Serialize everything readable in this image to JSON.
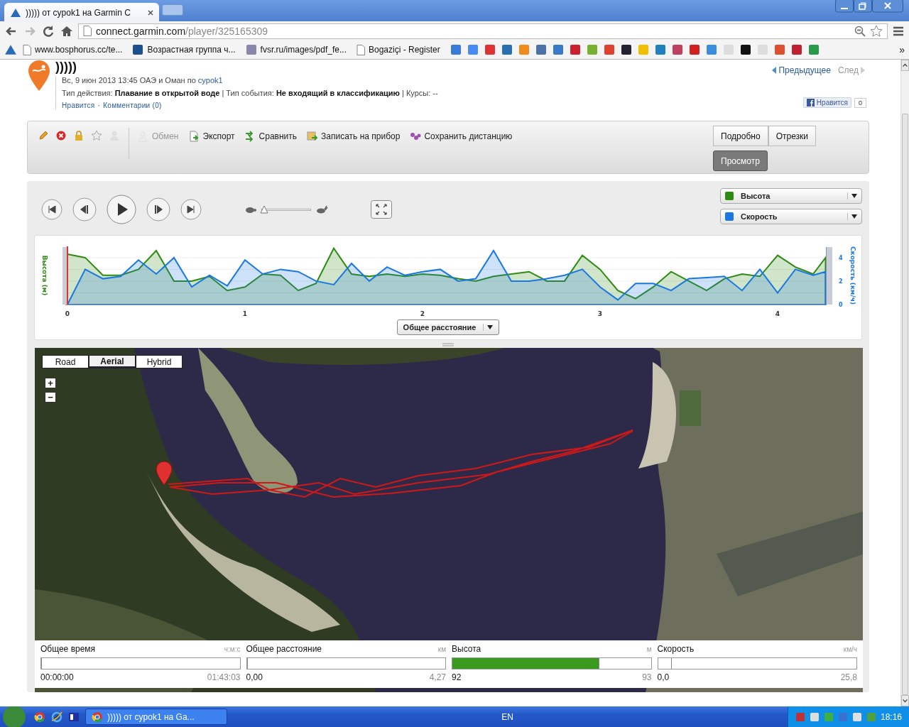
{
  "browser": {
    "tab_title": "))))) от cypok1 на Garmin C",
    "url_host": "connect.garmin.com",
    "url_path": "/player/325165309",
    "bookmarks": [
      "www.bosphorus.cc/te...",
      "Возрастная группа ч...",
      "fvsr.ru/images/pdf_fe...",
      "Bogaziçi - Register"
    ],
    "more": "»"
  },
  "activity": {
    "title": ")))))",
    "meta": "Вс, 9 июн 2013 13:45 ОАЭ и Оман по",
    "author": "cypok1",
    "details": "Тип действия: **Плавание в открытой воде** | Тип события: **Не входящий в классификацию** | Курсы: --",
    "like": "Нравится",
    "separator": "·",
    "comments": "Комментарии (0)",
    "prev": "Предыдущее",
    "next": "След",
    "next_disabled": true,
    "fb_like": "Нравится",
    "fb_count": "0"
  },
  "toolbar": {
    "icons": [
      {
        "kind": "edit",
        "disabled": false
      },
      {
        "kind": "delete",
        "disabled": false
      },
      {
        "kind": "lock",
        "disabled": false
      },
      {
        "kind": "star",
        "disabled": false
      },
      {
        "kind": "user",
        "disabled": true
      }
    ],
    "actions": [
      {
        "kind": "share",
        "label": "Обмен",
        "disabled": true
      },
      {
        "kind": "export",
        "label": "Экспорт",
        "disabled": false
      },
      {
        "kind": "compare",
        "label": "Сравнить",
        "disabled": false
      },
      {
        "kind": "device",
        "label": "Записать на прибор",
        "disabled": false
      },
      {
        "kind": "course",
        "label": "Сохранить дистанцию",
        "disabled": false
      }
    ],
    "views": [
      {
        "label": "Подробно",
        "selected": false
      },
      {
        "label": "Отрезки",
        "selected": false
      },
      {
        "label": "Просмотр",
        "selected": true
      }
    ]
  },
  "player": {
    "speed_slider": {
      "level": 0.05
    },
    "x_selector": "Общее расстояние",
    "chart": {
      "left_label": "Высота (м)",
      "chart_data": {
        "type": "area",
        "ylabel": "Скорость (км/ч)",
        "xlim": [
          0,
          4.27
        ],
        "ylim": [
          0,
          4.9
        ],
        "xticks": [
          0,
          1,
          2,
          3,
          4
        ],
        "yticks": [
          0,
          2,
          4
        ],
        "x": [
          0,
          0.1,
          0.2,
          0.3,
          0.4,
          0.5,
          0.6,
          0.7,
          0.8,
          0.9,
          1,
          1.1,
          1.2,
          1.3,
          1.4,
          1.5,
          1.6,
          1.7,
          1.8,
          1.9,
          2,
          2.1,
          2.2,
          2.3,
          2.4,
          2.5,
          2.6,
          2.7,
          2.8,
          2.9,
          3,
          3.1,
          3.2,
          3.3,
          3.4,
          3.5,
          3.6,
          3.7,
          3.8,
          3.9,
          4,
          4.1,
          4.2,
          4.27
        ],
        "series": [
          {
            "name": "Высота",
            "color": "#2e8a12",
            "values": [
              4.3,
              4,
              2.5,
              2.5,
              3,
              4.6,
              2,
              2,
              2.4,
              1.2,
              1.5,
              2.6,
              2.5,
              1.2,
              1.8,
              4.8,
              2.6,
              2.4,
              2.6,
              2.4,
              2.6,
              2.5,
              2.2,
              2,
              2.4,
              2.6,
              2.8,
              2,
              2,
              4.2,
              3,
              1.2,
              0.5,
              1.5,
              2.8,
              2,
              1.2,
              2.2,
              2.6,
              2.4,
              4.2,
              3.2,
              2.6,
              4
            ]
          },
          {
            "name": "Скорость",
            "color": "#1a78e0",
            "values": [
              0,
              3,
              2.2,
              2.4,
              3.8,
              2.6,
              4,
              1.5,
              2.5,
              1.6,
              3.8,
              2.6,
              3,
              2.8,
              2,
              1.7,
              3.5,
              2,
              3.2,
              2.5,
              2.8,
              3,
              2,
              2.2,
              4.6,
              2,
              2,
              2.2,
              2.5,
              3,
              1.5,
              0.4,
              1.8,
              1.8,
              1.2,
              2.2,
              2.3,
              2.4,
              1.2,
              3,
              1,
              3,
              2.5,
              2.8
            ]
          }
        ]
      }
    }
  },
  "map": {
    "types": [
      {
        "label": "Road",
        "selected": false
      },
      {
        "label": "Aerial",
        "selected": true
      },
      {
        "label": "Hybrid",
        "selected": false
      }
    ],
    "zoom_in": "+",
    "zoom_out": "−"
  },
  "stats": [
    {
      "label": "Общее время",
      "unit": "ч:м:с",
      "start": "00:00:00",
      "end": "01:43:03",
      "level": 0,
      "kind": "marker"
    },
    {
      "label": "Общее расстояние",
      "unit": "км",
      "start": "0,00",
      "end": "4,27",
      "level": 0,
      "kind": "marker"
    },
    {
      "label": "Высота",
      "unit": "м",
      "start": "92",
      "end": "93",
      "level": 0.74,
      "kind": "bar"
    },
    {
      "label": "Скорость",
      "unit": "км/ч",
      "start": "0,0",
      "end": "25,8",
      "level": 0.07,
      "kind": "marker"
    }
  ],
  "taskbar": {
    "task": "))))) от cypok1 на Ga...",
    "language": "EN",
    "time": "18:16"
  }
}
